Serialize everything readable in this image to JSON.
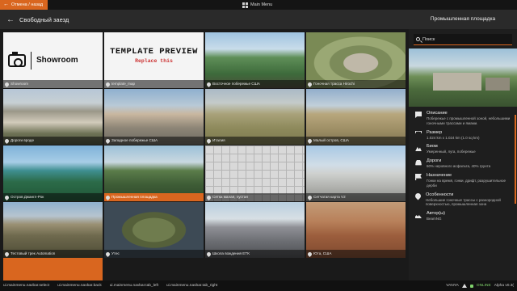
{
  "topbar": {
    "back_label": "Отмена / назад",
    "menu_label": "Main Menu"
  },
  "header": {
    "title": "Свободный заезд"
  },
  "tiles": [
    {
      "kind": "showroom",
      "name": "Showroom",
      "label": "Showroom"
    },
    {
      "kind": "template",
      "headline": "TEMPLATE PREVIEW",
      "sub": "Replace this",
      "label": "template_map"
    },
    {
      "kind": "th-coast",
      "label": "Восточное побережье США"
    },
    {
      "kind": "th-track1",
      "label": "Гоночная трасса Hirochi"
    },
    {
      "kind": "th-roads",
      "label": "Дороги вроде"
    },
    {
      "kind": "th-west",
      "label": "Западное побережье США"
    },
    {
      "kind": "th-italy",
      "label": "Италия"
    },
    {
      "kind": "th-desert",
      "label": "Малый остров, США"
    },
    {
      "kind": "th-island",
      "label": "Остров Джангл-Рок"
    },
    {
      "kind": "th-industrial",
      "label": "Промышленная площадка",
      "selected": true
    },
    {
      "kind": "th-grid",
      "label": "Сетка малая, пустая"
    },
    {
      "kind": "th-lab",
      "label": "Сетчатая карта V2"
    },
    {
      "kind": "th-auto",
      "label": "Тестовый трек Automation"
    },
    {
      "kind": "th-utah",
      "label": "Утес"
    },
    {
      "kind": "th-school",
      "label": "Школа вождения ETK"
    },
    {
      "kind": "th-utah2",
      "label": "Юта, США"
    }
  ],
  "panel": {
    "title": "Промышленная площадка",
    "search_placeholder": "Поиск",
    "info": [
      {
        "icon": "desc",
        "name": "description-icon",
        "heading": "Описание",
        "value": "Побережье с промышленной зоной, небольшими гоночными трассами и ямами."
      },
      {
        "icon": "size",
        "name": "size-icon",
        "heading": "Размер",
        "value": "1.024 km x 1.024 km (1.0 sq km)"
      },
      {
        "icon": "biome",
        "name": "biome-icon",
        "heading": "Биом",
        "value": "Умеренный, луга, побережье"
      },
      {
        "icon": "roads",
        "name": "roads-icon",
        "heading": "Дороги",
        "value": "60% неровного асфальта, 40% грунта"
      },
      {
        "icon": "flag",
        "name": "flag-icon",
        "heading": "Назначение",
        "value": "Гонки на время, гонки, дрифт, разрушительное дерби"
      },
      {
        "icon": "pinic",
        "name": "location-icon",
        "heading": "Особенности",
        "value": "Небольшие гоночные трассы с разнородной поверхностью, промышленная зона"
      },
      {
        "icon": "users",
        "name": "authors-icon",
        "heading": "Автор(ы)",
        "value": "BeamNG"
      }
    ]
  },
  "footer": {
    "hints": [
      "ui.mainmenu.navbar.select",
      "ui.mainmenu.navbar.back",
      "ui.mainmenu.navbar.tab_left",
      "ui.mainmenu.navbar.tab_right"
    ],
    "user": "VANYA",
    "status": "ONLINE",
    "version": "Alpha v0.3("
  }
}
